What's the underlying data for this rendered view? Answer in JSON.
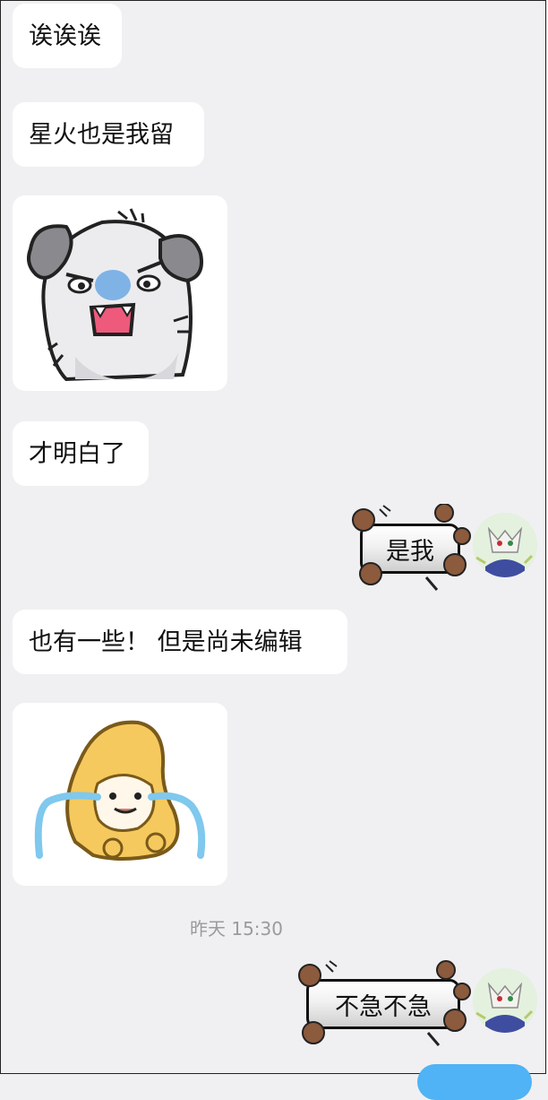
{
  "messages": {
    "m1": "诶诶诶",
    "m2": "星火也是我留",
    "m3": "才明白了",
    "m4": "是我",
    "m5": "也有一些！ 但是尚未编辑",
    "m6": "不急不急"
  },
  "timestamp": "昨天 15:30",
  "stickers": {
    "s1": "dog-sticker",
    "s2": "crying-bread-sticker"
  },
  "colors": {
    "background": "#f0f0f2",
    "bubble": "#ffffff",
    "send_button": "#4fb3f5"
  }
}
